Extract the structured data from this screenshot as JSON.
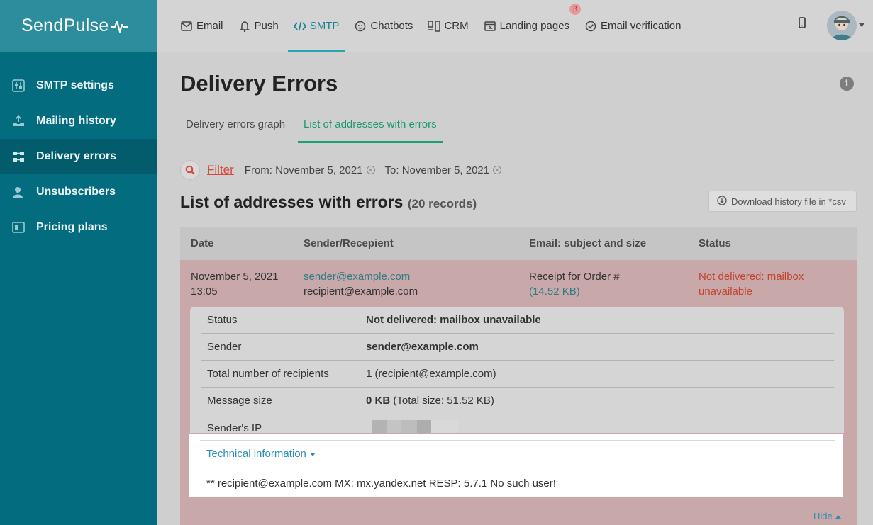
{
  "logo": {
    "text": "SendPulse"
  },
  "nav": {
    "items": [
      {
        "label": "Email",
        "icon": "mail-icon"
      },
      {
        "label": "Push",
        "icon": "bell-icon"
      },
      {
        "label": "SMTP",
        "icon": "code-icon",
        "active": true
      },
      {
        "label": "Chatbots",
        "icon": "chatbot-icon"
      },
      {
        "label": "CRM",
        "icon": "crm-icon"
      },
      {
        "label": "Landing pages",
        "icon": "landing-icon",
        "badge": "β"
      },
      {
        "label": "Email verification",
        "icon": "check-circle-icon"
      }
    ]
  },
  "sidebar": {
    "items": [
      {
        "label": "SMTP settings",
        "icon": "settings-sliders-icon"
      },
      {
        "label": "Mailing history",
        "icon": "inbox-upload-icon"
      },
      {
        "label": "Delivery errors",
        "icon": "delivery-errors-icon",
        "active": true
      },
      {
        "label": "Unsubscribers",
        "icon": "user-minus-icon"
      },
      {
        "label": "Pricing plans",
        "icon": "pricing-icon"
      }
    ]
  },
  "page": {
    "title": "Delivery Errors",
    "tabs": [
      {
        "label": "Delivery errors graph"
      },
      {
        "label": "List of addresses with errors",
        "active": true
      }
    ],
    "filter": {
      "label": "Filter",
      "from": "From: November 5, 2021",
      "to": "To: November 5, 2021"
    },
    "list_title": "List of addresses with errors",
    "record_count": "(20 records)",
    "download_label": "Download history file in *csv"
  },
  "table": {
    "headers": [
      "Date",
      "Sender/Recepient",
      "Email: subject and size",
      "Status"
    ],
    "row": {
      "date": "November 5, 2021",
      "time": "13:05",
      "sender": "sender@example.com",
      "recipient": "recipient@example.com",
      "subject": "Receipt for Order #",
      "size": "(14.52 KB)",
      "status_line1": "Not delivered: mailbox",
      "status_line2": "unavailable"
    },
    "details": {
      "status_key": "Status",
      "status_value": "Not delivered: mailbox unavailable",
      "sender_key": "Sender",
      "sender_value": "sender@example.com",
      "recipients_key": "Total number of recipients",
      "recipients_count": "1",
      "recipients_detail": "(recipient@example.com)",
      "size_key": "Message size",
      "size_value": "0 KB",
      "size_detail": "(Total size: 51.52 KB)",
      "ip_key": "Sender's IP"
    },
    "technical": {
      "link": "Technical information",
      "text": "** recipient@example.com MX: mx.yandex.net RESP: 5.7.1 No such user!"
    },
    "hide_label": "Hide"
  }
}
